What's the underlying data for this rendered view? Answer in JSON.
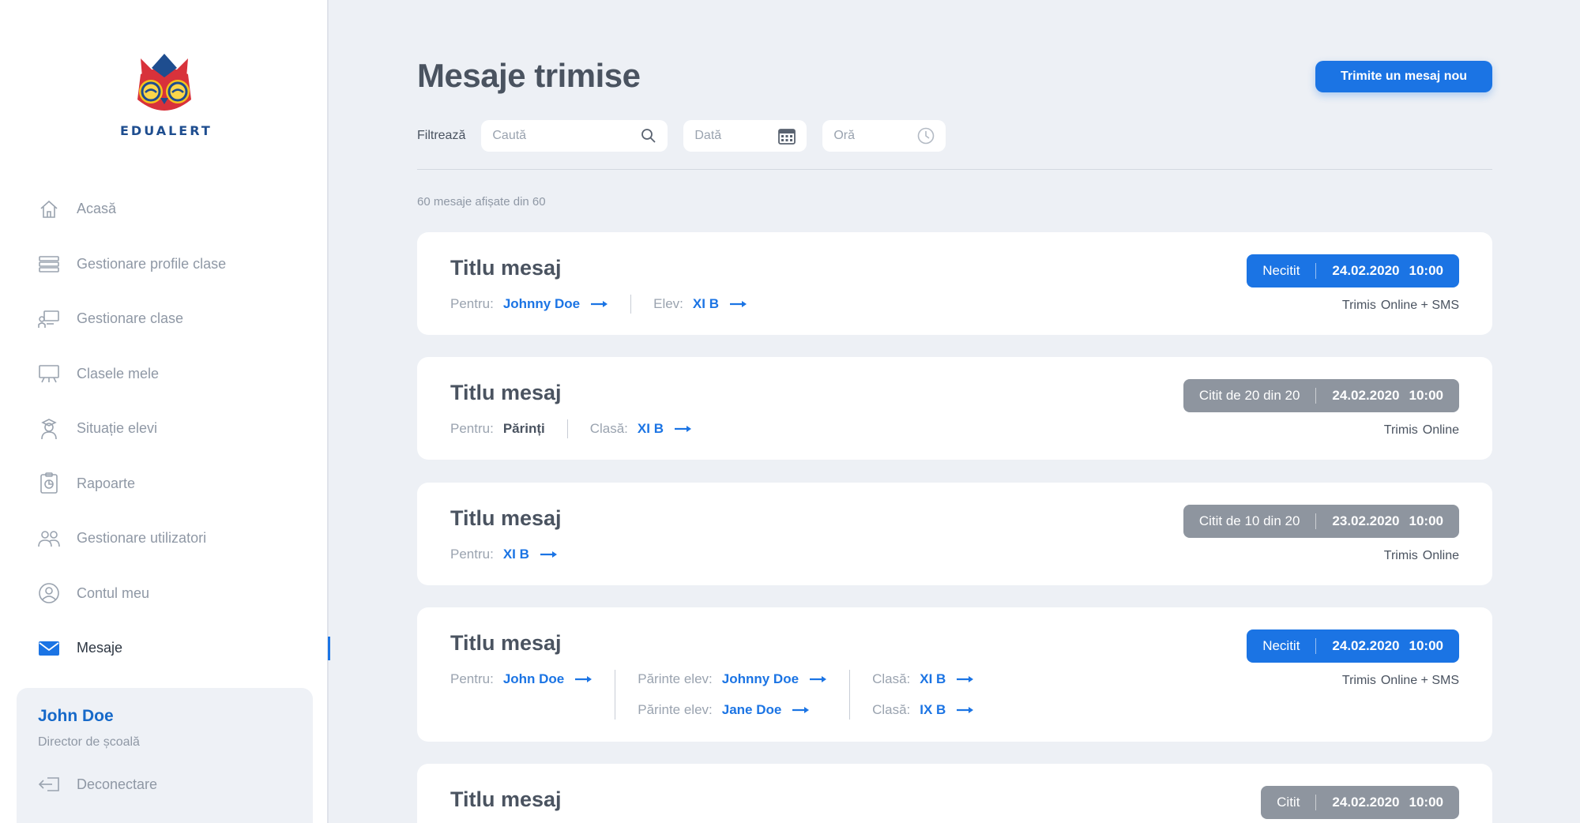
{
  "brand": {
    "name": "EDUALERT"
  },
  "sidebar": {
    "items": [
      {
        "label": "Acasă",
        "icon": "home-icon"
      },
      {
        "label": "Gestionare profile clase",
        "icon": "stack-icon"
      },
      {
        "label": "Gestionare clase",
        "icon": "classroom-icon"
      },
      {
        "label": "Clasele mele",
        "icon": "board-icon"
      },
      {
        "label": "Situație elevi",
        "icon": "student-icon"
      },
      {
        "label": "Rapoarte",
        "icon": "report-icon"
      },
      {
        "label": "Gestionare utilizatori",
        "icon": "users-icon"
      },
      {
        "label": "Contul meu",
        "icon": "account-icon"
      },
      {
        "label": "Mesaje",
        "icon": "mail-icon",
        "active": true
      }
    ],
    "user": {
      "name": "John Doe",
      "role": "Director de școală",
      "logout": "Deconectare"
    }
  },
  "header": {
    "title": "Mesaje trimise",
    "new_message_button": "Trimite un mesaj nou"
  },
  "filters": {
    "label": "Filtrează",
    "search_placeholder": "Caută",
    "date_placeholder": "Dată",
    "time_placeholder": "Oră"
  },
  "count_text": "60 mesaje afișate din 60",
  "colors": {
    "accent": "#1b74e4",
    "gray_badge": "#8e959f",
    "text": "#4a5360"
  },
  "messages": [
    {
      "title": "Titlu mesaj",
      "status": "Necitit",
      "date": "24.02.2020",
      "time": "10:00",
      "sent_label": "Trimis",
      "sent_via": "Online + SMS",
      "r1": {
        "k": "Pentru:",
        "v": "Johnny Doe"
      },
      "r2": {
        "k": "Elev:",
        "v": "XI B"
      }
    },
    {
      "title": "Titlu mesaj",
      "status": "Citit de 20 din 20",
      "date": "24.02.2020",
      "time": "10:00",
      "sent_label": "Trimis",
      "sent_via": "Online",
      "r1": {
        "k": "Pentru:",
        "v": "Părinți"
      },
      "r2": {
        "k": "Clasă:",
        "v": "XI B"
      }
    },
    {
      "title": "Titlu mesaj",
      "status": "Citit de 10 din 20",
      "date": "23.02.2020",
      "time": "10:00",
      "sent_label": "Trimis",
      "sent_via": "Online",
      "r1": {
        "k": "Pentru:",
        "v": "XI B"
      }
    },
    {
      "title": "Titlu mesaj",
      "status": "Necitit",
      "date": "24.02.2020",
      "time": "10:00",
      "sent_label": "Trimis",
      "sent_via": "Online + SMS",
      "r1": {
        "k": "Pentru:",
        "v": "John Doe"
      },
      "p1": {
        "k": "Părinte elev:",
        "v": "Johnny Doe"
      },
      "p2": {
        "k": "Părinte elev:",
        "v": "Jane Doe"
      },
      "c1": {
        "k": "Clasă:",
        "v": "XI B"
      },
      "c2": {
        "k": "Clasă:",
        "v": "IX B"
      }
    },
    {
      "title": "Titlu mesaj",
      "status": "Citit",
      "date": "24.02.2020",
      "time": "10:00"
    }
  ]
}
